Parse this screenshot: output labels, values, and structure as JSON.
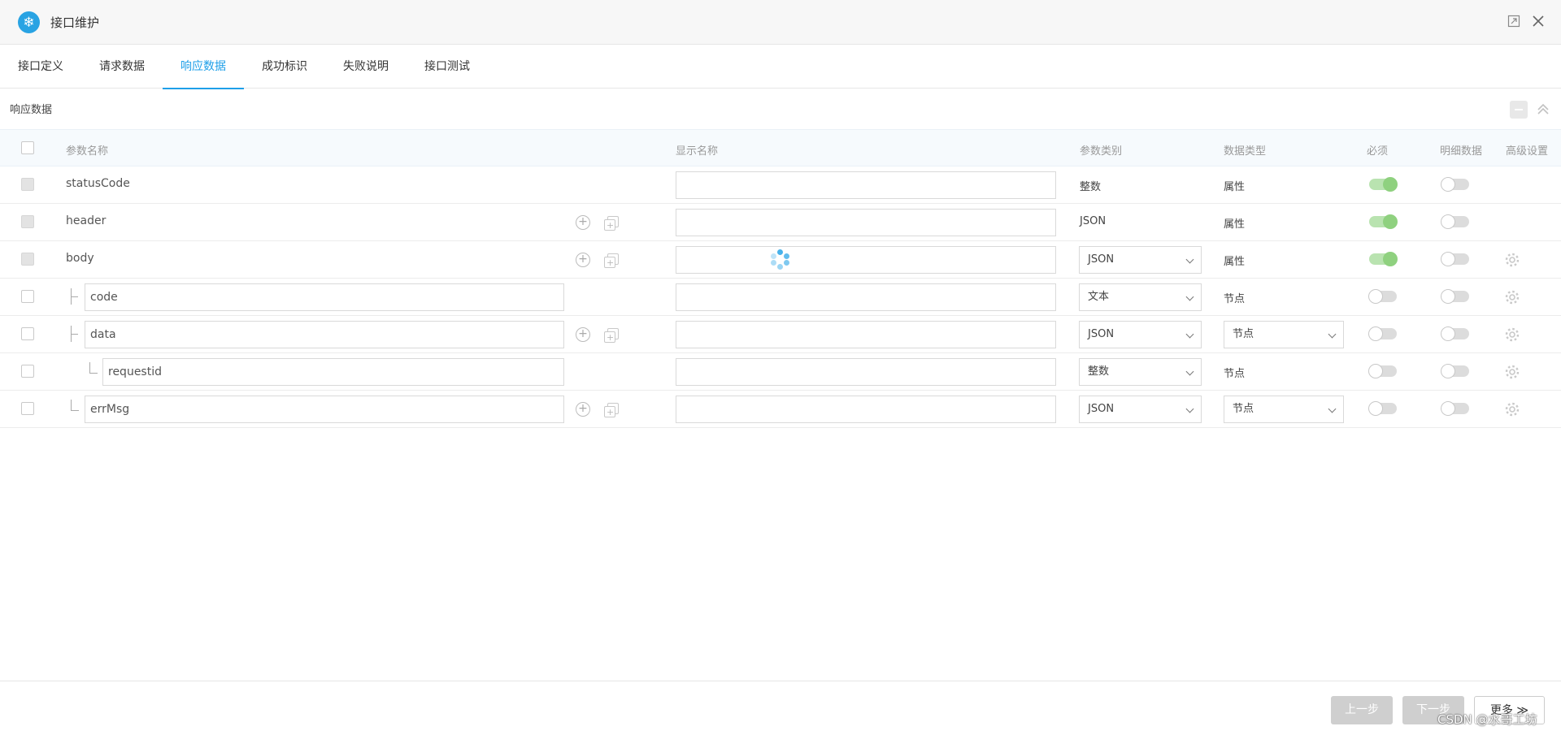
{
  "window": {
    "title": "接口维护"
  },
  "tabs": [
    {
      "label": "接口定义"
    },
    {
      "label": "请求数据"
    },
    {
      "label": "响应数据"
    },
    {
      "label": "成功标识"
    },
    {
      "label": "失败说明"
    },
    {
      "label": "接口测试"
    }
  ],
  "active_tab": "响应数据",
  "section": {
    "title": "响应数据"
  },
  "table": {
    "columns": [
      "参数名称",
      "显示名称",
      "参数类别",
      "数据类型",
      "必须",
      "明细数据",
      "高级设置"
    ],
    "rows": [
      {
        "name": "statusCode",
        "param_type": "整数",
        "data_type": "属性",
        "required": true,
        "detail": false
      },
      {
        "name": "header",
        "param_type": "JSON",
        "data_type": "属性",
        "required": true,
        "detail": false
      },
      {
        "name": "body",
        "param_type": "JSON",
        "data_type": "属性",
        "required": true,
        "detail": false
      },
      {
        "name": "code",
        "param_type": "文本",
        "data_type": "节点",
        "required": false,
        "detail": false
      },
      {
        "name": "data",
        "param_type": "JSON",
        "data_type": "节点",
        "required": false,
        "detail": false
      },
      {
        "name": "requestid",
        "param_type": "整数",
        "data_type": "节点",
        "required": false,
        "detail": false
      },
      {
        "name": "errMsg",
        "param_type": "JSON",
        "data_type": "节点",
        "required": false,
        "detail": false
      }
    ]
  },
  "footer": {
    "prev_label": "上一步",
    "next_label": "下一步",
    "more_label": "更多 ≫"
  },
  "watermark": "CSDN @水哥工坊",
  "colors": {
    "accent": "#1e9fe8",
    "toggle_on": "#8fd17f"
  }
}
